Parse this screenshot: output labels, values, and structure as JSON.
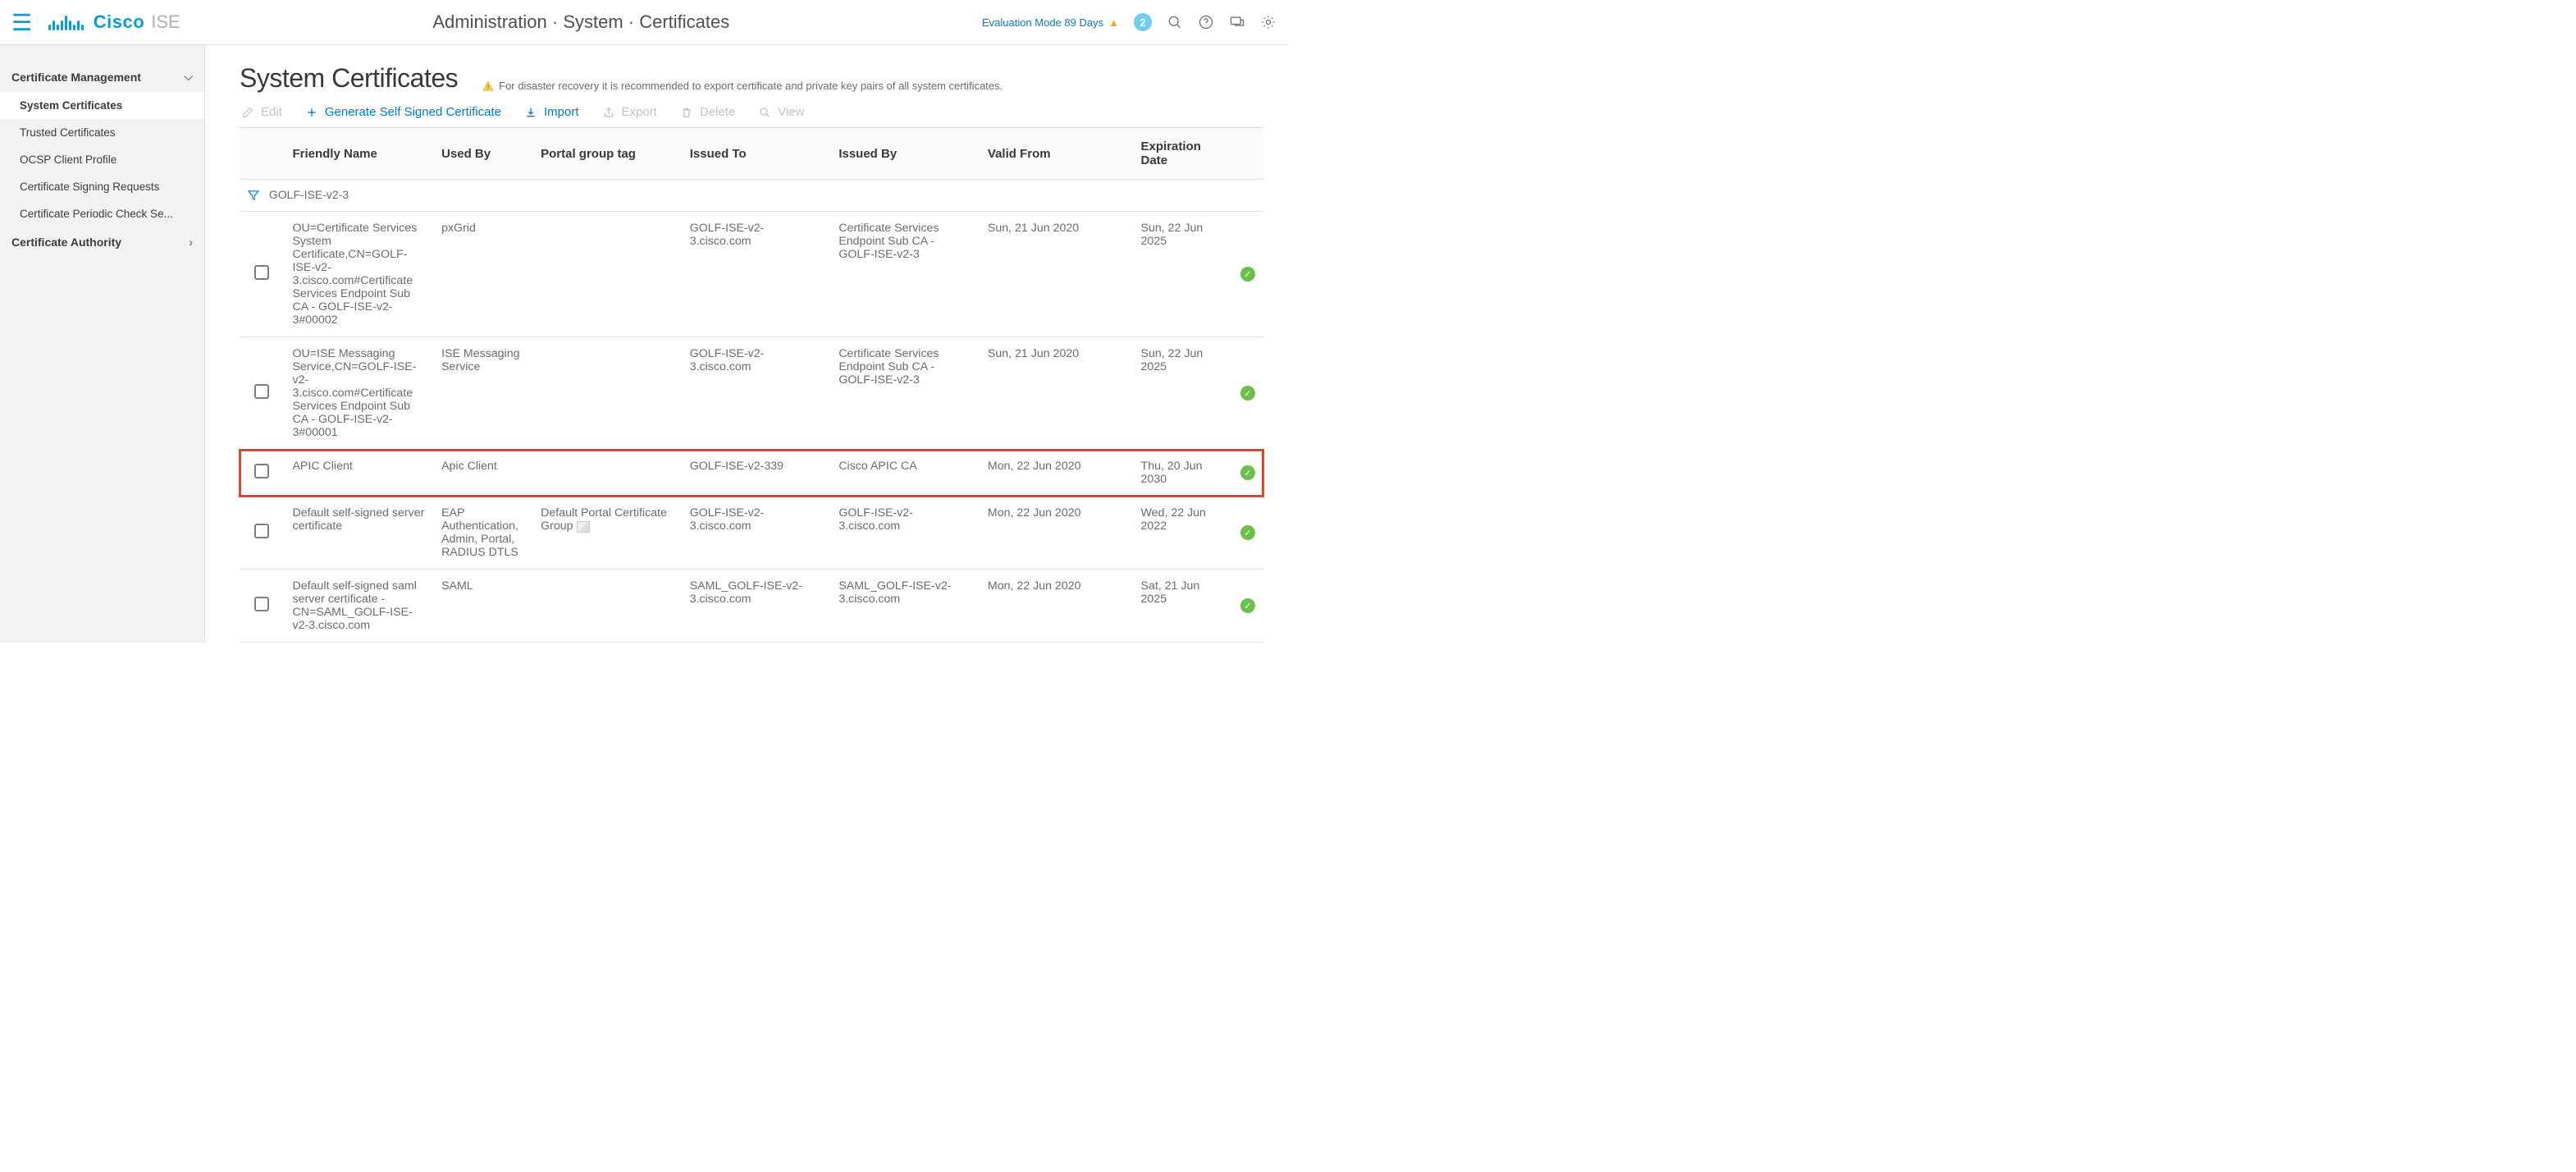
{
  "header": {
    "brand1": "Cisco",
    "brand2": "ISE",
    "breadcrumb": "Administration · System · Certificates",
    "eval_mode": "Evaluation Mode 89 Days",
    "notif_count": "2"
  },
  "sidebar": {
    "groups": [
      {
        "title": "Certificate Management",
        "expanded": true,
        "items": [
          {
            "label": "System Certificates",
            "active": true
          },
          {
            "label": "Trusted Certificates"
          },
          {
            "label": "OCSP Client Profile"
          },
          {
            "label": "Certificate Signing Requests"
          },
          {
            "label": "Certificate Periodic Check Se..."
          }
        ]
      },
      {
        "title": "Certificate Authority",
        "expanded": false,
        "items": []
      }
    ]
  },
  "main": {
    "title": "System Certificates",
    "note": "For disaster recovery it is recommended to export certificate and private key pairs of all system certificates.",
    "toolbar": {
      "edit": "Edit",
      "generate": "Generate Self Signed Certificate",
      "import": "Import",
      "export": "Export",
      "delete": "Delete",
      "view": "View"
    },
    "columns": [
      "Friendly Name",
      "Used By",
      "Portal group tag",
      "Issued To",
      "Issued By",
      "Valid From",
      "Expiration Date"
    ],
    "filter_label": "GOLF-ISE-v2-3",
    "rows": [
      {
        "friendly": "OU=Certificate Services System Certificate,CN=GOLF-ISE-v2-3.cisco.com#Certificate Services Endpoint Sub CA - GOLF-ISE-v2-3#00002",
        "used_by": "pxGrid",
        "portal_tag": "",
        "issued_to": "GOLF-ISE-v2-3.cisco.com",
        "issued_by": "Certificate Services Endpoint Sub CA - GOLF-ISE-v2-3",
        "valid_from": "Sun, 21 Jun 2020",
        "expiration": "Sun, 22 Jun 2025",
        "status": "ok"
      },
      {
        "friendly": "OU=ISE Messaging Service,CN=GOLF-ISE-v2-3.cisco.com#Certificate Services Endpoint Sub CA - GOLF-ISE-v2-3#00001",
        "used_by": "ISE Messaging Service",
        "portal_tag": "",
        "issued_to": "GOLF-ISE-v2-3.cisco.com",
        "issued_by": "Certificate Services Endpoint Sub CA - GOLF-ISE-v2-3",
        "valid_from": "Sun, 21 Jun 2020",
        "expiration": "Sun, 22 Jun 2025",
        "status": "ok"
      },
      {
        "friendly": "APIC Client",
        "used_by": "Apic Client",
        "portal_tag": "",
        "issued_to": "GOLF-ISE-v2-339",
        "issued_by": "Cisco APIC CA",
        "valid_from": "Mon, 22 Jun 2020",
        "expiration": "Thu, 20 Jun 2030",
        "status": "ok",
        "highlight": true
      },
      {
        "friendly": "Default self-signed server certificate",
        "used_by": "EAP Authentication, Admin, Portal, RADIUS DTLS",
        "portal_tag": "Default Portal Certificate Group",
        "portal_tag_broken_img": true,
        "issued_to": "GOLF-ISE-v2-3.cisco.com",
        "issued_by": "GOLF-ISE-v2-3.cisco.com",
        "valid_from": "Mon, 22 Jun 2020",
        "expiration": "Wed, 22 Jun 2022",
        "status": "ok"
      },
      {
        "friendly": "Default self-signed saml server certificate - CN=SAML_GOLF-ISE-v2-3.cisco.com",
        "used_by": "SAML",
        "portal_tag": "",
        "issued_to": "SAML_GOLF-ISE-v2-3.cisco.com",
        "issued_by": "SAML_GOLF-ISE-v2-3.cisco.com",
        "valid_from": "Mon, 22 Jun 2020",
        "expiration": "Sat, 21 Jun 2025",
        "status": "ok"
      }
    ]
  }
}
